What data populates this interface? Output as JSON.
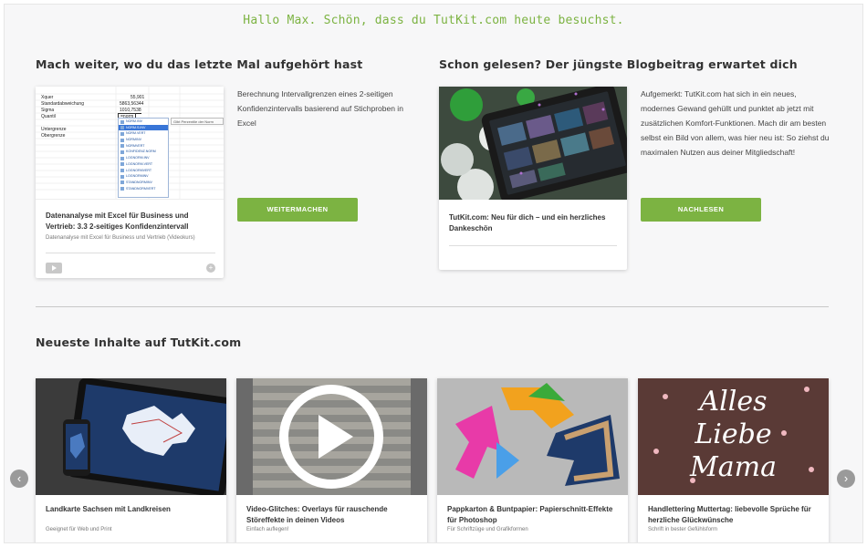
{
  "greeting": "Hallo Max. Schön, dass du TutKit.com heute besuchst.",
  "continue_section": {
    "title": "Mach weiter, wo du das letzte Mal aufgehört hast",
    "sheet_rows": [
      {
        "label": "Xquer",
        "value": "55,901"
      },
      {
        "label": "Standardabweichung",
        "value": "5863,56344"
      },
      {
        "label": "Sigma",
        "value": "1010,7538"
      },
      {
        "label": "Quantil",
        "value": "=norm"
      },
      {
        "label": "Untergrenze",
        "value": ""
      },
      {
        "label": "Obergrenze",
        "value": ""
      }
    ],
    "dropdown_items": [
      "NORM.INV",
      "NORM.S.INV",
      "NORM.VERT",
      "NORMINV",
      "NORMVERT",
      "KONFIDENZ.NORM",
      "LOGNORM.INV",
      "LOGNORM.VERT",
      "LOGNORMVERT",
      "LOGNORMINV",
      "STANDNORMINV",
      "STANDNORMVERT"
    ],
    "tooltip": "Gibt Perzentile der Norm",
    "card_title": "Datenanalyse mit Excel für Business und Vertrieb: 3.3 2-seitiges Konfidenzintervall",
    "card_sub": "Datenanalyse mit Excel für Business und Vertrieb (Videokurs)",
    "description": "Berechnung Intervallgrenzen eines 2-seitigen Konfidenzintervalls basierend auf Stichproben in Excel",
    "button": "WEITERMACHEN"
  },
  "blog_section": {
    "title": "Schon gelesen? Der jüngste Blogbeitrag erwartet dich",
    "card_title": "TutKit.com: Neu für dich – und ein herzliches Dankeschön",
    "description": "Aufgemerkt: TutKit.com hat sich in ein neues, modernes Gewand gehüllt und punktet ab jetzt mit zusätzlichen Komfort-Funktionen. Mach dir am besten selbst ein Bild von allem, was hier neu ist: So ziehst du maximalen Nutzen aus deiner Mitgliedschaft!",
    "button": "NACHLESEN"
  },
  "newest_section": {
    "title": "Neueste Inhalte auf TutKit.com",
    "cards": [
      {
        "title": "Landkarte Sachsen mit Landkreisen",
        "sub": "Geeignet für Web und Print"
      },
      {
        "title": "Video-Glitches: Overlays für rauschende Störeffekte in deinen Videos",
        "sub": "Einfach auflegen!"
      },
      {
        "title": "Pappkarton & Buntpapier: Papierschnitt-Effekte für Photoshop",
        "sub": "Für Schriftzüge und Grafikformen"
      },
      {
        "title": "Handlettering Muttertag: liebevolle Sprüche für herzliche Glückwünsche",
        "sub": "Schrift in bester Gefühlsform"
      }
    ],
    "lettering": [
      "Alles",
      "Liebe",
      "Mama"
    ]
  },
  "icons": {
    "prev": "chevron-left-icon",
    "next": "chevron-right-icon",
    "video": "video-icon",
    "add": "plus-icon"
  },
  "colors": {
    "accent": "#7cb342",
    "background": "#f7f7f8"
  }
}
